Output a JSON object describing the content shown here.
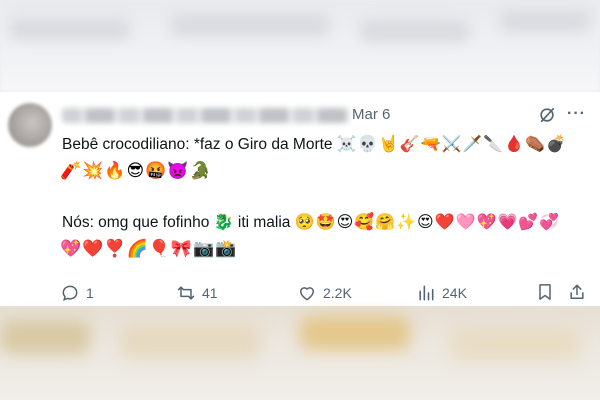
{
  "tweet": {
    "date": "Mar 6",
    "line1_text": "Bebê crocodiliano: *faz o Giro da Morte",
    "line1_emojis": "☠️💀🤘🎸🔫⚔️🗡️🔪🩸⚰️💣",
    "line2_emojis": "🧨💥🔥😎🤬👿🐊",
    "line3_text": "Nós: omg que fofinho",
    "line3_text2": "iti malia",
    "line3_emoji_croc": "🐉",
    "line3_emojis": "🥺🤩😍🥰🤗✨😍❤️🩷💖💗💕💞",
    "line4_emojis": "💖❤️❣️🌈🎈🎀📷📸"
  },
  "actions": {
    "replies": "1",
    "retweets": "41",
    "likes": "2.2K",
    "views": "24K"
  },
  "icons": [
    "grok-icon",
    "more-icon",
    "reply-icon",
    "retweet-icon",
    "like-icon",
    "views-icon",
    "bookmark-icon",
    "share-icon"
  ],
  "colors": {
    "text": "#0f1419",
    "muted": "#536471",
    "background": "#ffffff"
  }
}
